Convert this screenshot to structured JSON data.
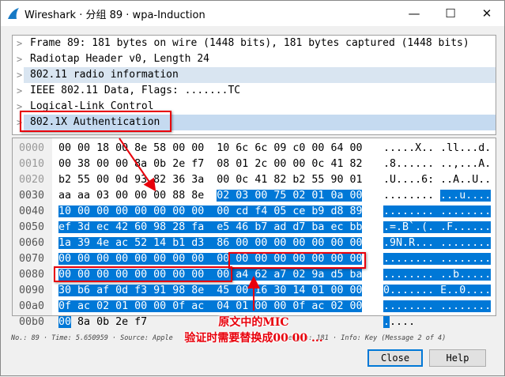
{
  "window": {
    "title": "Wireshark · 分组 89 · wpa-Induction",
    "minimize": "—",
    "maximize": "☐",
    "close": "✕"
  },
  "tree": [
    {
      "label": "Frame 89: 181 bytes on wire (1448 bits), 181 bytes captured (1448 bits)",
      "state": "normal"
    },
    {
      "label": "Radiotap Header v0, Length 24",
      "state": "normal"
    },
    {
      "label": "802.11 radio information",
      "state": "hl"
    },
    {
      "label": "IEEE 802.11 Data, Flags: .......TC",
      "state": "normal"
    },
    {
      "label": "Logical-Link Control",
      "state": "normal"
    },
    {
      "label": "802.1X Authentication",
      "state": "sel"
    }
  ],
  "hex": {
    "selection": {
      "start": 56,
      "end": 176
    },
    "rows": [
      {
        "offset": "0000",
        "bytes": "00 00 18 00 8e 58 00 00 10 6c 6c 09 c0 00 64 00",
        "ascii": ".....X.. .ll...d."
      },
      {
        "offset": "0010",
        "bytes": "00 38 00 00 8a 0b 2e f7 08 01 2c 00 00 0c 41 82",
        "ascii": ".8...... ..,...A."
      },
      {
        "offset": "0020",
        "bytes": "b2 55 00 0d 93 82 36 3a 00 0c 41 82 b2 55 90 01",
        "ascii": ".U....6: ..A..U.."
      },
      {
        "offset": "0030",
        "bytes": "aa aa 03 00 00 00 88 8e 02 03 00 75 02 01 0a 00",
        "ascii": "........ ...u...."
      },
      {
        "offset": "0040",
        "bytes": "10 00 00 00 00 00 00 00 00 cd f4 05 ce b9 d8 89",
        "ascii": "........ ........"
      },
      {
        "offset": "0050",
        "bytes": "ef 3d ec 42 60 98 28 fa e5 46 b7 ad d7 ba ec bb",
        "ascii": ".=.B`.(. .F......"
      },
      {
        "offset": "0060",
        "bytes": "1a 39 4e ac 52 14 b1 d3 86 00 00 00 00 00 00 00",
        "ascii": ".9N.R... ........"
      },
      {
        "offset": "0070",
        "bytes": "00 00 00 00 00 00 00 00 00 00 00 00 00 00 00 00",
        "ascii": "........ ........"
      },
      {
        "offset": "0080",
        "bytes": "00 00 00 00 00 00 00 00 00 a4 62 a7 02 9a d5 ba",
        "ascii": "........ ..b....."
      },
      {
        "offset": "0090",
        "bytes": "30 b6 af 0d f3 91 98 8e 45 00 16 30 14 01 00 00",
        "ascii": "0....... E..0...."
      },
      {
        "offset": "00a0",
        "bytes": "0f ac 02 01 00 00 0f ac 04 01 00 00 0f ac 02 00",
        "ascii": "........ ........"
      },
      {
        "offset": "00b0",
        "bytes": "00 8a 0b 2e f7",
        "ascii": "....."
      }
    ]
  },
  "annotation": {
    "line1": "原文中的MIC",
    "line2": "验证时需要替换成00 00 ...",
    "color": "#e8000b"
  },
  "status": "No.: 89 · Time: 5.650959 · Source: Apple",
  "status_tail": "ength: 181 · Info: Key (Message 2 of 4)",
  "buttons": {
    "close": "Close",
    "help": "Help"
  }
}
